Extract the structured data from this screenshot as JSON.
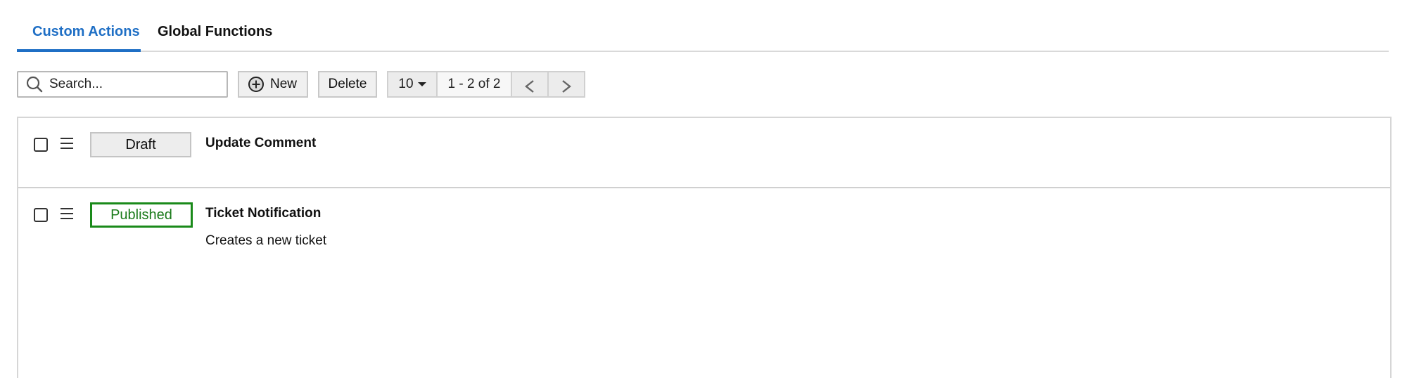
{
  "tabs": [
    {
      "label": "Custom Actions",
      "active": true
    },
    {
      "label": "Global Functions",
      "active": false
    }
  ],
  "toolbar": {
    "search_placeholder": "Search...",
    "new_label": "New",
    "delete_label": "Delete",
    "page_size": "10",
    "range_text": "1 - 2 of 2"
  },
  "rows": [
    {
      "status": "Draft",
      "title": "Update Comment",
      "description": ""
    },
    {
      "status": "Published",
      "title": "Ticket Notification",
      "description": "Creates a new ticket"
    }
  ],
  "colors": {
    "accent": "#1f6fc5",
    "published": "#1a8a1a"
  }
}
